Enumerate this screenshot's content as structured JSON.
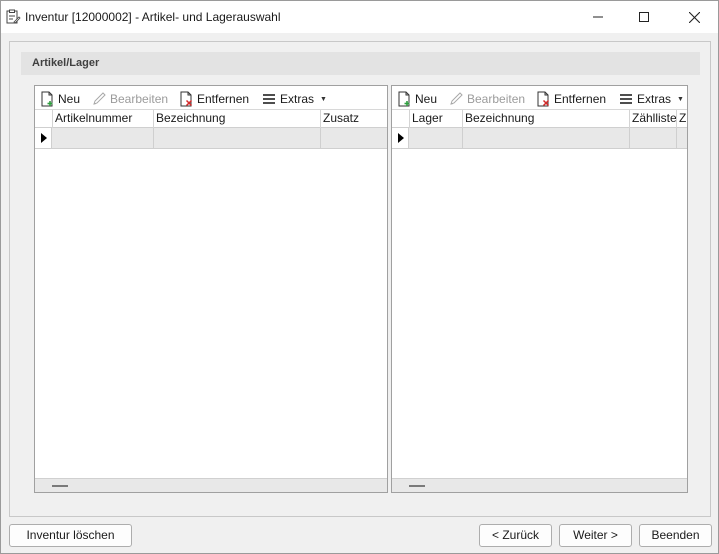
{
  "window": {
    "title": "Inventur [12000002] - Artikel- und Lagerauswahl"
  },
  "section": {
    "title": "Artikel/Lager"
  },
  "left_grid": {
    "toolbar": {
      "new_label": "Neu",
      "edit_label": "Bearbeiten",
      "remove_label": "Entfernen",
      "extras_label": "Extras"
    },
    "columns": [
      "Artikelnummer",
      "Bezeichnung",
      "Zusatz"
    ]
  },
  "right_grid": {
    "toolbar": {
      "new_label": "Neu",
      "edit_label": "Bearbeiten",
      "remove_label": "Entfernen",
      "extras_label": "Extras"
    },
    "columns": [
      "Lager",
      "Bezeichnung",
      "Zählliste",
      "Zu"
    ]
  },
  "buttons": {
    "delete_label": "Inventur löschen",
    "back_label": "< Zurück",
    "next_label": "Weiter >",
    "end_label": "Beenden"
  }
}
